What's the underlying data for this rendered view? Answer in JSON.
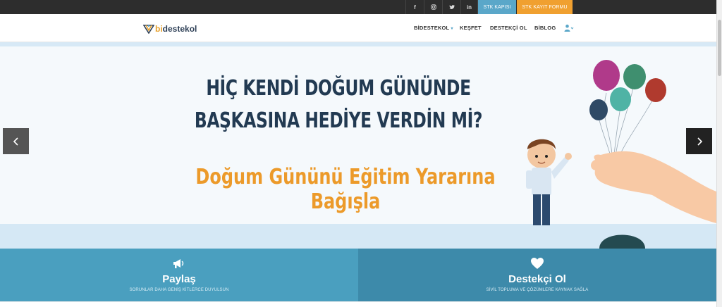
{
  "topbar": {
    "social": [
      {
        "icon": "facebook-icon",
        "glyph": "f"
      },
      {
        "icon": "instagram-icon",
        "glyph": ""
      },
      {
        "icon": "twitter-icon",
        "glyph": ""
      },
      {
        "icon": "linkedin-icon",
        "glyph": "in"
      }
    ],
    "stk_kapisi": "STK KAPISI",
    "stk_kayit": "STK KAYIT FORMU"
  },
  "header": {
    "logo_bi": "bi",
    "logo_rest": "destekol",
    "nav": {
      "bidestekol": "BİDESTEKOL",
      "kesfet": "KEŞFET",
      "destekci_ol": "DESTEKÇİ OL",
      "biblog": "BİBLOG"
    }
  },
  "hero": {
    "title_line1": "HİÇ KENDİ DOĞUM GÜNÜNDE",
    "title_line2": "BAŞKASINA HEDİYE VERDİN Mİ?",
    "subtitle": "Doğum Gününü Eğitim Yararına Bağışla"
  },
  "panels": {
    "paylas": {
      "title": "Paylaş",
      "desc": "SORUNLAR DAHA GENİŞ KİTLERCE DUYULSUN"
    },
    "destekci": {
      "title": "Destekçi Ol",
      "desc": "SİVİL TOPLUMA VE ÇÖZÜMLERE KAYNAK SAĞLA"
    }
  },
  "colors": {
    "topbar": "#2d2d2d",
    "accent_blue": "#5aa7c9",
    "accent_orange": "#f0a030",
    "title_navy": "#223a52",
    "subtitle_orange": "#ec9a2a",
    "panel_left": "#4a9fbf",
    "panel_right": "#3d8aaa"
  }
}
